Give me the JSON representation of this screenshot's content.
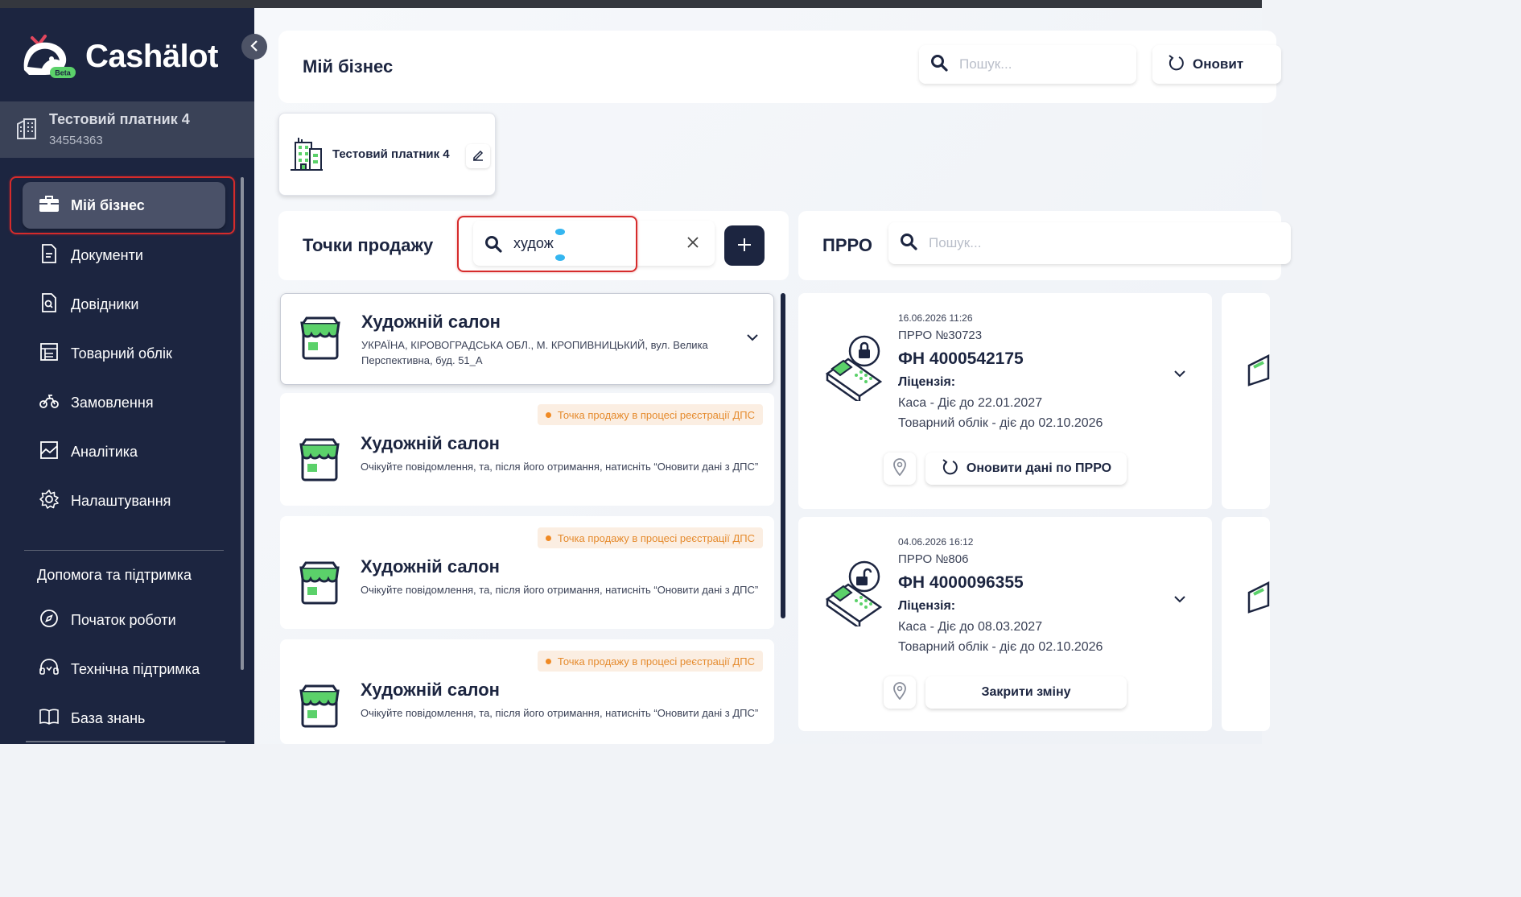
{
  "brand": {
    "name": "Cashälot",
    "badge": "Beta"
  },
  "company": {
    "name": "Тестовий платник 4",
    "code": "34554363"
  },
  "nav": {
    "items": [
      {
        "label": "Мій бізнес"
      },
      {
        "label": "Документи"
      },
      {
        "label": "Довідники"
      },
      {
        "label": "Товарний облік"
      },
      {
        "label": "Замовлення"
      },
      {
        "label": "Аналітика"
      },
      {
        "label": "Налаштування"
      }
    ],
    "support_title": "Допомога та підтримка",
    "support_items": [
      {
        "label": "Початок роботи"
      },
      {
        "label": "Технічна підтримка"
      },
      {
        "label": "База знань"
      }
    ]
  },
  "header": {
    "title": "Мій бізнес",
    "search_placeholder": "Пошук...",
    "refresh_label": "Оновит"
  },
  "company_card": {
    "name": "Тестовий платник 4"
  },
  "sales_points": {
    "title": "Точки продажу",
    "search_value": "худож",
    "items": [
      {
        "title": "Художній салон",
        "subtitle": "УКРАЇНА, КІРОВОГРАДСЬКА ОБЛ., М. КРОПИВНИЦЬКИЙ, вул. Велика Перспективна, буд. 51_А"
      },
      {
        "status": "Точка продажу в процесі реєстрації ДПС",
        "title": "Художній салон",
        "subtitle": "Очікуйте повідомлення, та, після його отримання, натисніть “Оновити дані з ДПС”"
      },
      {
        "status": "Точка продажу в процесі реєстрації ДПС",
        "title": "Художній салон",
        "subtitle": "Очікуйте повідомлення, та, після його отримання, натисніть “Оновити дані з ДПС”"
      },
      {
        "status": "Точка продажу в процесі реєстрації ДПС",
        "title": "Художній салон",
        "subtitle": "Очікуйте повідомлення, та, після його отримання, натисніть “Оновити дані з ДПС”"
      }
    ]
  },
  "prro": {
    "title": "ПРРО",
    "search_placeholder": "Пошук...",
    "items": [
      {
        "date": "16.06.2026 11:26",
        "number": "ПРРО №30723",
        "fn": "ФН 4000542175",
        "license_label": "Ліцензія:",
        "line1": "Каса - Діє до 22.01.2027",
        "line2": "Товарний облік - діє до 02.10.2026",
        "action": "Оновити дані по ПРРО"
      },
      {
        "date": "04.06.2026 16:12",
        "number": "ПРРО №806",
        "fn": "ФН 4000096355",
        "license_label": "Ліцензія:",
        "line1": "Каса - Діє до 08.03.2027",
        "line2": "Товарний облік - діє до 02.10.2026",
        "action": "Закрити зміну"
      }
    ]
  },
  "colors": {
    "sidebar": "#1c2540",
    "accent_green": "#5bd16a",
    "status_orange": "#f08a24",
    "highlight_red": "#d62b2b"
  }
}
